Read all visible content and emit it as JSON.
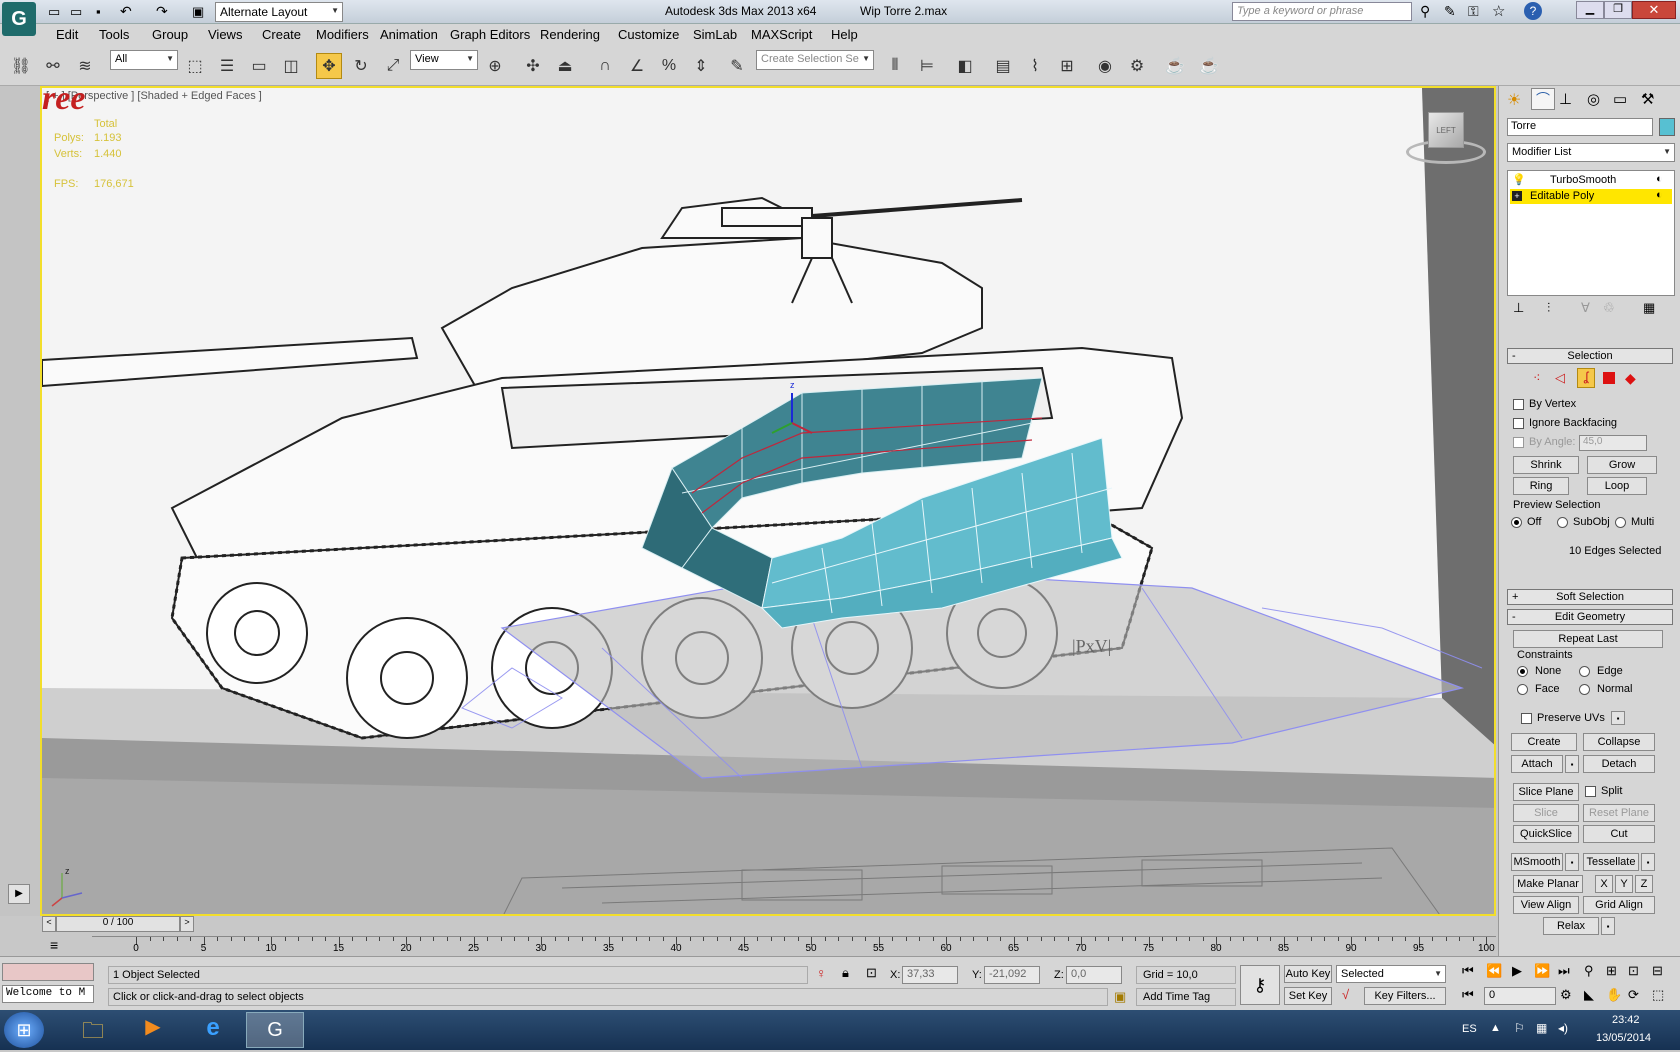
{
  "title": {
    "workspace": "Alternate Layout",
    "app": "Autodesk 3ds Max  2013 x64",
    "file": "Wip Torre 2.max",
    "search_placeholder": "Type a keyword or phrase"
  },
  "menu": [
    "Edit",
    "Tools",
    "Group",
    "Views",
    "Create",
    "Modifiers",
    "Animation",
    "Graph Editors",
    "Rendering",
    "Customize",
    "SimLab",
    "MAXScript",
    "Help"
  ],
  "toolbar": {
    "selection_filter": "All",
    "ref_coord": "View",
    "named_selection_placeholder": "Create Selection Se"
  },
  "viewport": {
    "label": "[ + ] [Perspective ] [Shaded + Edged Faces ]",
    "stats_total": "Total",
    "polys_label": "Polys:",
    "polys_value": "1.193",
    "verts_label": "Verts:",
    "verts_value": "1.440",
    "fps_label": "FPS:",
    "fps_value": "176,671",
    "viewcube_label": "LEFT",
    "watermark": "ree",
    "stamp": "|PxV|"
  },
  "command_panel": {
    "object_name": "Torre",
    "modifier_list": "Modifier List",
    "stack": [
      {
        "label": "TurboSmooth",
        "selected": false
      },
      {
        "label": "Editable Poly",
        "selected": true
      }
    ],
    "selection": {
      "header": "Selection",
      "by_vertex": "By Vertex",
      "ignore_backfacing": "Ignore Backfacing",
      "by_angle": "By Angle:",
      "by_angle_value": "45,0",
      "shrink": "Shrink",
      "grow": "Grow",
      "ring": "Ring",
      "loop": "Loop",
      "preview_group": "Preview Selection",
      "off": "Off",
      "subobj": "SubObj",
      "multi": "Multi",
      "status": "10 Edges Selected"
    },
    "soft_selection": "Soft Selection",
    "edit_geometry": {
      "header": "Edit Geometry",
      "repeat_last": "Repeat Last",
      "constraints": "Constraints",
      "none": "None",
      "edge": "Edge",
      "face": "Face",
      "normal": "Normal",
      "preserve_uvs": "Preserve UVs",
      "create": "Create",
      "collapse": "Collapse",
      "attach": "Attach",
      "detach": "Detach",
      "slice_plane": "Slice Plane",
      "split": "Split",
      "slice": "Slice",
      "reset_plane": "Reset Plane",
      "quickslice": "QuickSlice",
      "cut": "Cut",
      "msmooth": "MSmooth",
      "tessellate": "Tessellate",
      "make_planar": "Make Planar",
      "x": "X",
      "y": "Y",
      "z": "Z",
      "view_align": "View Align",
      "grid_align": "Grid Align",
      "relax": "Relax"
    }
  },
  "timeline": {
    "frame": "0 / 100",
    "ticks": [
      "0",
      "5",
      "10",
      "15",
      "20",
      "25",
      "30",
      "35",
      "40",
      "45",
      "50",
      "55",
      "60",
      "65",
      "70",
      "75",
      "80",
      "85",
      "90",
      "95",
      "100"
    ]
  },
  "status": {
    "listener": "Welcome to M",
    "selected": "1 Object Selected",
    "prompt": "Click or click-and-drag to select objects",
    "x_label": "X:",
    "x_value": "37,33",
    "y_label": "Y:",
    "y_value": "-21,092",
    "z_label": "Z:",
    "z_value": "0,0",
    "grid": "Grid = 10,0",
    "add_time_tag": "Add Time Tag",
    "auto_key": "Auto Key",
    "set_key": "Set Key",
    "key_mode": "Selected",
    "key_filters": "Key Filters...",
    "current_frame": "0"
  },
  "taskbar": {
    "lang": "ES",
    "time": "23:42",
    "date": "13/05/2014"
  }
}
